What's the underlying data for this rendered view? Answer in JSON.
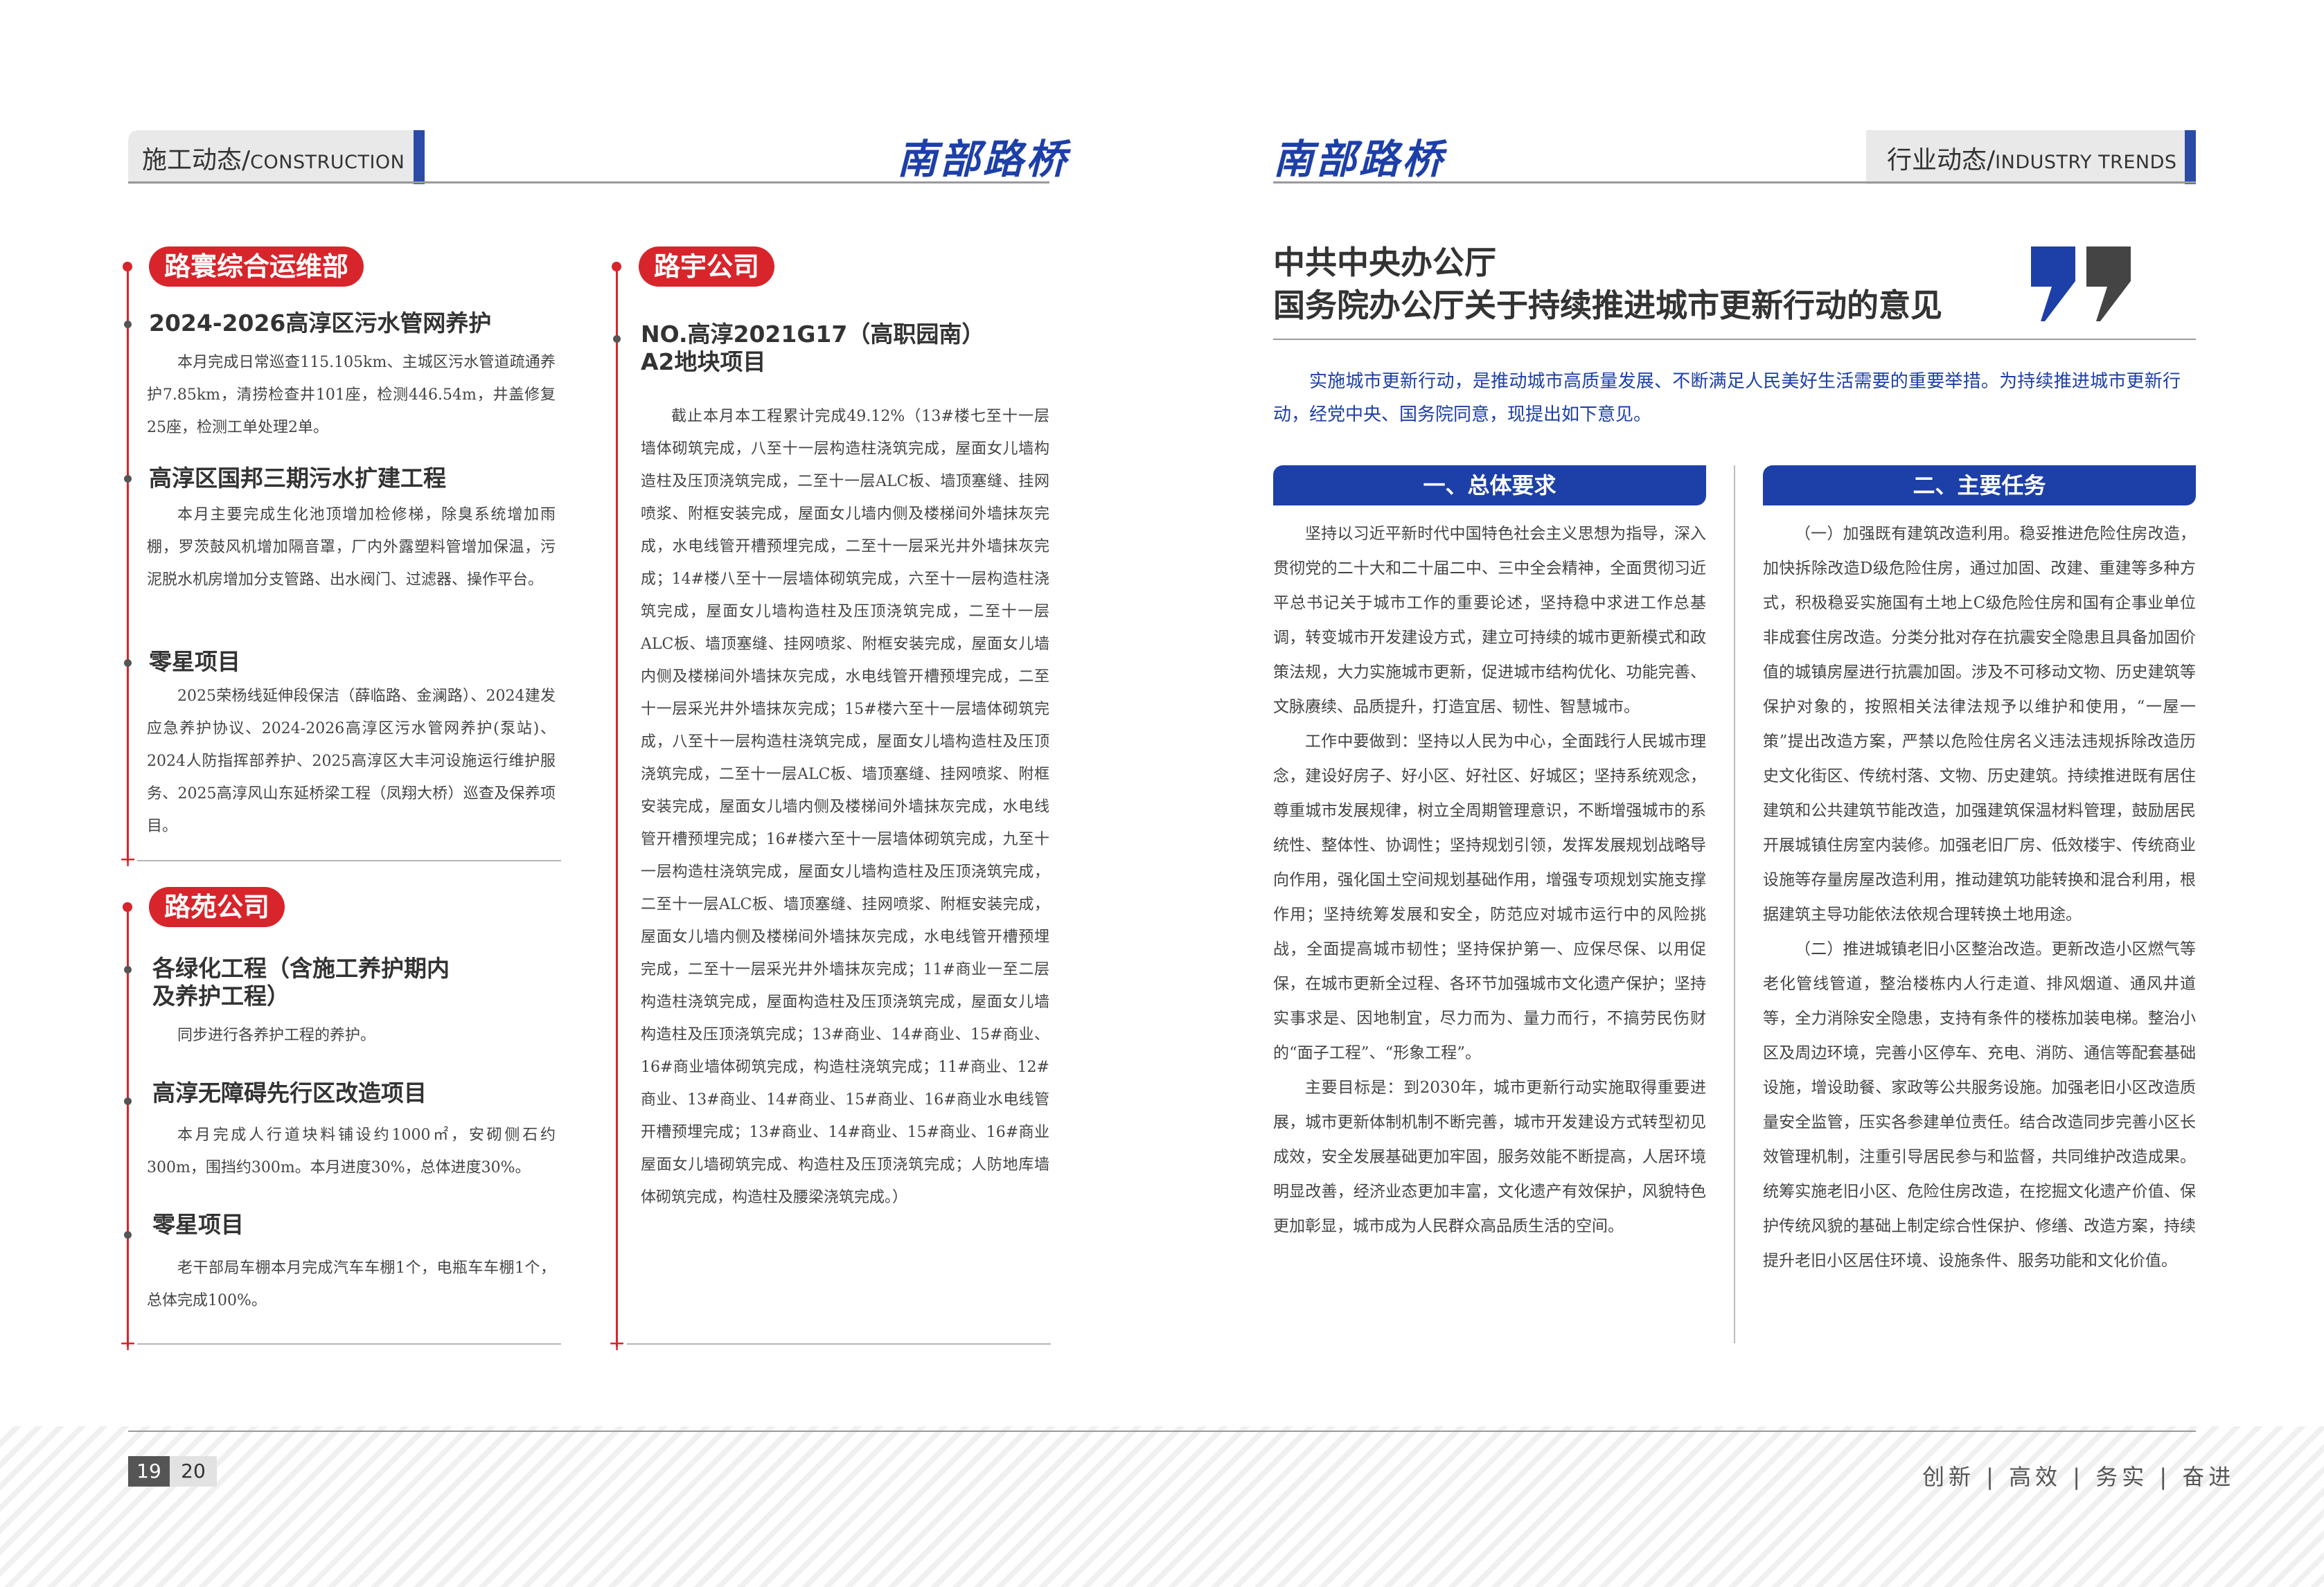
{
  "header": {
    "left_tab_zh": "施工动态",
    "left_tab_sep": "/",
    "left_tab_en": "CONSTRUCTION",
    "brand": "南部路桥",
    "right_tab_zh": "行业动态",
    "right_tab_sep": "/",
    "right_tab_en": "INDUSTRY TRENDS"
  },
  "left_page": {
    "col1": {
      "section1": {
        "pill": "路寰综合运维部",
        "items": [
          {
            "title": "2024-2026高淳区污水管网养护",
            "body": "本月完成日常巡查115.105km、主城区污水管道疏通养护7.85km，清捞检查井101座，检测446.54m，井盖修复25座，检测工单处理2单。"
          },
          {
            "title": "高淳区国邦三期污水扩建工程",
            "body": "本月主要完成生化池顶增加检修梯，除臭系统增加雨棚，罗茨鼓风机增加隔音罩，厂内外露塑料管增加保温，污泥脱水机房增加分支管路、出水阀门、过滤器、操作平台。"
          },
          {
            "title": "零星项目",
            "body": "2025荣杨线延伸段保洁（薛临路、金澜路）、2024建发应急养护协议、2024-2026高淳区污水管网养护(泵站)、2024人防指挥部养护、2025高淳区大丰河设施运行维护服务、2025高淳风山东延桥梁工程（凤翔大桥）巡查及保养项目。"
          }
        ]
      },
      "section2": {
        "pill": "路苑公司",
        "items": [
          {
            "title": "各绿化工程（含施工养护期内及养护工程）",
            "title_l1": "各绿化工程（含施工养护期内",
            "title_l2": "及养护工程）",
            "body": "同步进行各养护工程的养护。"
          },
          {
            "title": "高淳无障碍先行区改造项目",
            "body": "本月完成人行道块料铺设约1000㎡，安砌侧石约300m，围挡约300m。本月进度30%，总体进度30%。"
          },
          {
            "title": "零星项目",
            "body": "老干部局车棚本月完成汽车车棚1个，电瓶车车棚1个，总体完成100%。"
          }
        ]
      }
    },
    "col2": {
      "pill": "路宇公司",
      "title_l1": "NO.高淳2021G17（高职园南）",
      "title_l2": "A2地块项目",
      "body": "截止本月本工程累计完成49.12%（13#楼七至十一层墙体砌筑完成，八至十一层构造柱浇筑完成，屋面女儿墙构造柱及压顶浇筑完成，二至十一层ALC板、墙顶塞缝、挂网喷浆、附框安装完成，屋面女儿墙内侧及楼梯间外墙抹灰完成，水电线管开槽预埋完成，二至十一层采光井外墙抹灰完成；14#楼八至十一层墙体砌筑完成，六至十一层构造柱浇筑完成，屋面女儿墙构造柱及压顶浇筑完成，二至十一层ALC板、墙顶塞缝、挂网喷浆、附框安装完成，屋面女儿墙内侧及楼梯间外墙抹灰完成，水电线管开槽预埋完成，二至十一层采光井外墙抹灰完成；15#楼六至十一层墙体砌筑完成，八至十一层构造柱浇筑完成，屋面女儿墙构造柱及压顶浇筑完成，二至十一层ALC板、墙顶塞缝、挂网喷浆、附框安装完成，屋面女儿墙内侧及楼梯间外墙抹灰完成，水电线管开槽预埋完成；16#楼六至十一层墙体砌筑完成，九至十一层构造柱浇筑完成，屋面女儿墙构造柱及压顶浇筑完成，二至十一层ALC板、墙顶塞缝、挂网喷浆、附框安装完成，屋面女儿墙内侧及楼梯间外墙抹灰完成，水电线管开槽预埋完成，二至十一层采光井外墙抹灰完成；11#商业一至二层构造柱浇筑完成，屋面构造柱及压顶浇筑完成，屋面女儿墙构造柱及压顶浇筑完成；13#商业、14#商业、15#商业、16#商业墙体砌筑完成，构造柱浇筑完成；11#商业、12#商业、13#商业、14#商业、15#商业、16#商业水电线管开槽预埋完成；13#商业、14#商业、15#商业、16#商业屋面女儿墙砌筑完成、构造柱及压顶浇筑完成；人防地库墙体砌筑完成，构造柱及腰梁浇筑完成。）"
    }
  },
  "right_page": {
    "title_l1": "中共中央办公厅",
    "title_l2": "国务院办公厅关于持续推进城市更新行动的意见",
    "lead": "实施城市更新行动，是推动城市高质量发展、不断满足人民美好生活需要的重要举措。为持续推进城市更新行动，经党中央、国务院同意，现提出如下意见。",
    "section1": {
      "heading": "一、总体要求",
      "paragraphs": [
        "坚持以习近平新时代中国特色社会主义思想为指导，深入贯彻党的二十大和二十届二中、三中全会精神，全面贯彻习近平总书记关于城市工作的重要论述，坚持稳中求进工作总基调，转变城市开发建设方式，建立可持续的城市更新模式和政策法规，大力实施城市更新，促进城市结构优化、功能完善、文脉赓续、品质提升，打造宜居、韧性、智慧城市。",
        "工作中要做到：坚持以人民为中心，全面践行人民城市理念，建设好房子、好小区、好社区、好城区；坚持系统观念，尊重城市发展规律，树立全周期管理意识，不断增强城市的系统性、整体性、协调性；坚持规划引领，发挥发展规划战略导向作用，强化国土空间规划基础作用，增强专项规划实施支撑作用；坚持统筹发展和安全，防范应对城市运行中的风险挑战，全面提高城市韧性；坚持保护第一、应保尽保、以用促保，在城市更新全过程、各环节加强城市文化遗产保护；坚持实事求是、因地制宜，尽力而为、量力而行，不搞劳民伤财的“面子工程”、“形象工程”。",
        "主要目标是：到2030年，城市更新行动实施取得重要进展，城市更新体制机制不断完善，城市开发建设方式转型初见成效，安全发展基础更加牢固，服务效能不断提高，人居环境明显改善，经济业态更加丰富，文化遗产有效保护，风貌特色更加彰显，城市成为人民群众高品质生活的空间。"
      ]
    },
    "section2": {
      "heading": "二、主要任务",
      "paragraphs": [
        "（一）加强既有建筑改造利用。稳妥推进危险住房改造，加快拆除改造D级危险住房，通过加固、改建、重建等多种方式，积极稳妥实施国有土地上C级危险住房和国有企事业单位非成套住房改造。分类分批对存在抗震安全隐患且具备加固价值的城镇房屋进行抗震加固。涉及不可移动文物、历史建筑等保护对象的，按照相关法律法规予以维护和使用，“一屋一策”提出改造方案，严禁以危险住房名义违法违规拆除改造历史文化街区、传统村落、文物、历史建筑。持续推进既有居住建筑和公共建筑节能改造，加强建筑保温材料管理，鼓励居民开展城镇住房室内装修。加强老旧厂房、低效楼宇、传统商业设施等存量房屋改造利用，推动建筑功能转换和混合利用，根据建筑主导功能依法依规合理转换土地用途。",
        "（二）推进城镇老旧小区整治改造。更新改造小区燃气等老化管线管道，整治楼栋内人行走道、排风烟道、通风井道等，全力消除安全隐患，支持有条件的楼栋加装电梯。整治小区及周边环境，完善小区停车、充电、消防、通信等配套基础设施，增设助餐、家政等公共服务设施。加强老旧小区改造质量安全监管，压实各参建单位责任。结合改造同步完善小区长效管理机制，注重引导居民参与和监督，共同维护改造成果。统筹实施老旧小区、危险住房改造，在挖掘文化遗产价值、保护传统风貌的基础上制定综合性保护、修缮、改造方案，持续提升老旧小区居住环境、设施条件、服务功能和文化价值。"
      ]
    }
  },
  "footer": {
    "page_left": "19",
    "page_right": "20",
    "slogan": "创新 | 高效 | 务实 | 奋进"
  },
  "colors": {
    "brand_blue": "#1d3fa8",
    "accent_red": "#d7252b",
    "gray": "#e9e9e9"
  }
}
